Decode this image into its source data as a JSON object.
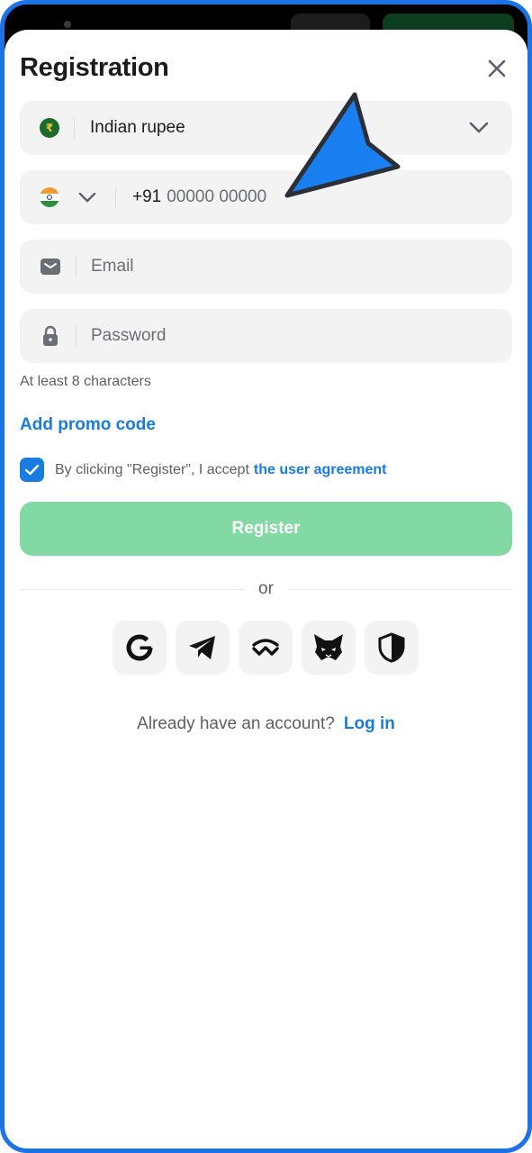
{
  "header": {
    "title": "Registration"
  },
  "currency": {
    "label": "Indian rupee",
    "symbol": "₹"
  },
  "phone": {
    "country_code": "+91",
    "placeholder": "00000 00000"
  },
  "email": {
    "placeholder": "Email"
  },
  "password": {
    "placeholder": "Password",
    "hint": "At least 8 characters"
  },
  "promo": {
    "label": "Add promo code"
  },
  "agreement": {
    "checked": true,
    "text": "By clicking \"Register\", I accept",
    "link_label": "the user agreement"
  },
  "register": {
    "label": "Register"
  },
  "divider": {
    "label": "or"
  },
  "social": {
    "icons": [
      "google-icon",
      "telegram-icon",
      "walletconnect-icon",
      "metamask-icon",
      "shield-icon"
    ]
  },
  "login": {
    "text": "Already have an account?",
    "link_label": "Log in"
  },
  "colors": {
    "accent": "#1a7be0",
    "register_disabled": "#82d9a3",
    "field_bg": "#f3f3f4",
    "frame_border": "#1a73e8",
    "cursor": "#1a7ff0"
  }
}
